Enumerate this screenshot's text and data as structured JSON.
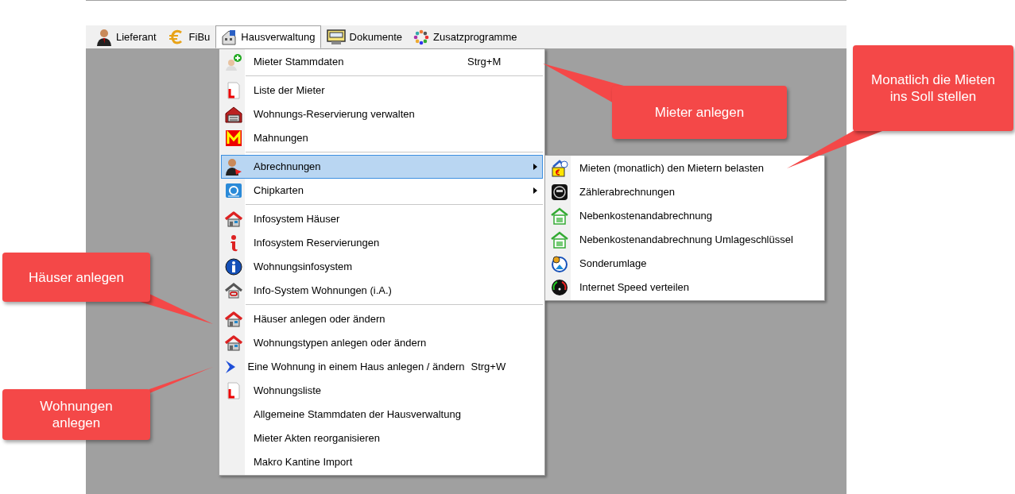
{
  "menubar": [
    {
      "label": "Lieferant",
      "selected": false
    },
    {
      "label": "FiBu",
      "selected": false
    },
    {
      "label": "Hausverwaltung",
      "selected": true
    },
    {
      "label": "Dokumente",
      "selected": false
    },
    {
      "label": "Zusatzprogramme",
      "selected": false
    }
  ],
  "menu": {
    "items": [
      {
        "kind": "item",
        "label": "Mieter Stammdaten",
        "shortcut": "Strg+M",
        "submenu": false,
        "selected": false
      },
      {
        "kind": "separator"
      },
      {
        "kind": "item",
        "label": "Liste der Mieter",
        "submenu": false,
        "selected": false
      },
      {
        "kind": "item",
        "label": "Wohnungs-Reservierung verwalten",
        "submenu": false,
        "selected": false
      },
      {
        "kind": "item",
        "label": "Mahnungen",
        "submenu": false,
        "selected": false
      },
      {
        "kind": "separator"
      },
      {
        "kind": "item",
        "label": "Abrechnungen",
        "submenu": true,
        "selected": true
      },
      {
        "kind": "item",
        "label": "Chipkarten",
        "submenu": true,
        "selected": false
      },
      {
        "kind": "separator"
      },
      {
        "kind": "item",
        "label": "Infosystem Häuser",
        "submenu": false,
        "selected": false
      },
      {
        "kind": "item",
        "label": "Infosystem Reservierungen",
        "submenu": false,
        "selected": false
      },
      {
        "kind": "item",
        "label": "Wohnungsinfosystem",
        "submenu": false,
        "selected": false
      },
      {
        "kind": "item",
        "label": "Info-System Wohnungen (i.A.)",
        "submenu": false,
        "selected": false
      },
      {
        "kind": "separator"
      },
      {
        "kind": "item",
        "label": "Häuser anlegen oder ändern",
        "submenu": false,
        "selected": false
      },
      {
        "kind": "item",
        "label": "Wohnungstypen anlegen oder ändern",
        "submenu": false,
        "selected": false
      },
      {
        "kind": "item",
        "label": "Eine Wohnung in einem Haus anlegen / ändern",
        "shortcut": "Strg+W",
        "submenu": false,
        "selected": false
      },
      {
        "kind": "item",
        "label": "Wohnungsliste",
        "submenu": false,
        "selected": false
      },
      {
        "kind": "item",
        "label": "Allgemeine Stammdaten der Hausverwaltung",
        "submenu": false,
        "selected": false
      },
      {
        "kind": "item",
        "label": "Mieter Akten reorganisieren",
        "submenu": false,
        "selected": false
      },
      {
        "kind": "item",
        "label": "Makro Kantine Import",
        "submenu": false,
        "selected": false
      }
    ]
  },
  "submenu": {
    "items": [
      {
        "label": "Mieten (monatlich) den Mietern belasten"
      },
      {
        "label": "Zählerabrechnungen"
      },
      {
        "label": "Nebenkostenandabrechnung"
      },
      {
        "label": "Nebenkostenandabrechnung Umlageschlüssel"
      },
      {
        "label": "Sonderumlage"
      },
      {
        "label": "Internet Speed verteilen"
      }
    ]
  },
  "callouts": [
    {
      "text": "Mieter anlegen"
    },
    {
      "text": "Monatlich die Mieten ins Soll stellen"
    },
    {
      "text": "Häuser anlegen"
    },
    {
      "text": "Wohnungen anlegen"
    }
  ]
}
